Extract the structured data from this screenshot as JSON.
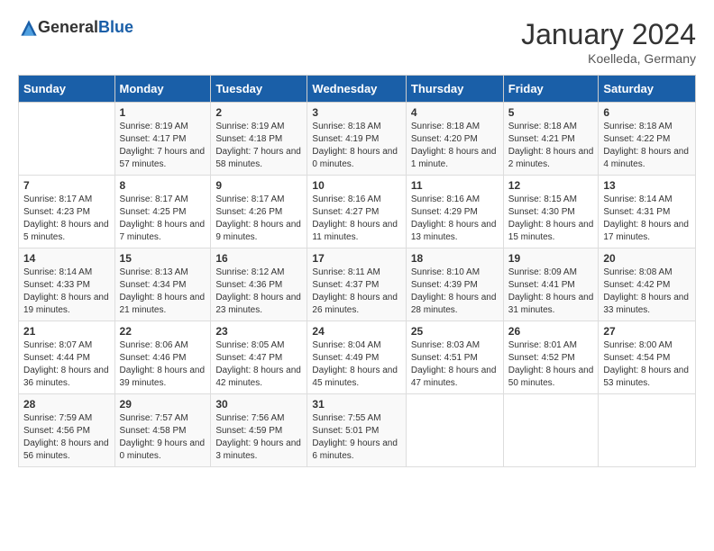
{
  "header": {
    "logo_general": "General",
    "logo_blue": "Blue",
    "month_year": "January 2024",
    "location": "Koelleda, Germany"
  },
  "days_of_week": [
    "Sunday",
    "Monday",
    "Tuesday",
    "Wednesday",
    "Thursday",
    "Friday",
    "Saturday"
  ],
  "weeks": [
    [
      {
        "num": "",
        "sunrise": "",
        "sunset": "",
        "daylight": ""
      },
      {
        "num": "1",
        "sunrise": "Sunrise: 8:19 AM",
        "sunset": "Sunset: 4:17 PM",
        "daylight": "Daylight: 7 hours and 57 minutes."
      },
      {
        "num": "2",
        "sunrise": "Sunrise: 8:19 AM",
        "sunset": "Sunset: 4:18 PM",
        "daylight": "Daylight: 7 hours and 58 minutes."
      },
      {
        "num": "3",
        "sunrise": "Sunrise: 8:18 AM",
        "sunset": "Sunset: 4:19 PM",
        "daylight": "Daylight: 8 hours and 0 minutes."
      },
      {
        "num": "4",
        "sunrise": "Sunrise: 8:18 AM",
        "sunset": "Sunset: 4:20 PM",
        "daylight": "Daylight: 8 hours and 1 minute."
      },
      {
        "num": "5",
        "sunrise": "Sunrise: 8:18 AM",
        "sunset": "Sunset: 4:21 PM",
        "daylight": "Daylight: 8 hours and 2 minutes."
      },
      {
        "num": "6",
        "sunrise": "Sunrise: 8:18 AM",
        "sunset": "Sunset: 4:22 PM",
        "daylight": "Daylight: 8 hours and 4 minutes."
      }
    ],
    [
      {
        "num": "7",
        "sunrise": "Sunrise: 8:17 AM",
        "sunset": "Sunset: 4:23 PM",
        "daylight": "Daylight: 8 hours and 5 minutes."
      },
      {
        "num": "8",
        "sunrise": "Sunrise: 8:17 AM",
        "sunset": "Sunset: 4:25 PM",
        "daylight": "Daylight: 8 hours and 7 minutes."
      },
      {
        "num": "9",
        "sunrise": "Sunrise: 8:17 AM",
        "sunset": "Sunset: 4:26 PM",
        "daylight": "Daylight: 8 hours and 9 minutes."
      },
      {
        "num": "10",
        "sunrise": "Sunrise: 8:16 AM",
        "sunset": "Sunset: 4:27 PM",
        "daylight": "Daylight: 8 hours and 11 minutes."
      },
      {
        "num": "11",
        "sunrise": "Sunrise: 8:16 AM",
        "sunset": "Sunset: 4:29 PM",
        "daylight": "Daylight: 8 hours and 13 minutes."
      },
      {
        "num": "12",
        "sunrise": "Sunrise: 8:15 AM",
        "sunset": "Sunset: 4:30 PM",
        "daylight": "Daylight: 8 hours and 15 minutes."
      },
      {
        "num": "13",
        "sunrise": "Sunrise: 8:14 AM",
        "sunset": "Sunset: 4:31 PM",
        "daylight": "Daylight: 8 hours and 17 minutes."
      }
    ],
    [
      {
        "num": "14",
        "sunrise": "Sunrise: 8:14 AM",
        "sunset": "Sunset: 4:33 PM",
        "daylight": "Daylight: 8 hours and 19 minutes."
      },
      {
        "num": "15",
        "sunrise": "Sunrise: 8:13 AM",
        "sunset": "Sunset: 4:34 PM",
        "daylight": "Daylight: 8 hours and 21 minutes."
      },
      {
        "num": "16",
        "sunrise": "Sunrise: 8:12 AM",
        "sunset": "Sunset: 4:36 PM",
        "daylight": "Daylight: 8 hours and 23 minutes."
      },
      {
        "num": "17",
        "sunrise": "Sunrise: 8:11 AM",
        "sunset": "Sunset: 4:37 PM",
        "daylight": "Daylight: 8 hours and 26 minutes."
      },
      {
        "num": "18",
        "sunrise": "Sunrise: 8:10 AM",
        "sunset": "Sunset: 4:39 PM",
        "daylight": "Daylight: 8 hours and 28 minutes."
      },
      {
        "num": "19",
        "sunrise": "Sunrise: 8:09 AM",
        "sunset": "Sunset: 4:41 PM",
        "daylight": "Daylight: 8 hours and 31 minutes."
      },
      {
        "num": "20",
        "sunrise": "Sunrise: 8:08 AM",
        "sunset": "Sunset: 4:42 PM",
        "daylight": "Daylight: 8 hours and 33 minutes."
      }
    ],
    [
      {
        "num": "21",
        "sunrise": "Sunrise: 8:07 AM",
        "sunset": "Sunset: 4:44 PM",
        "daylight": "Daylight: 8 hours and 36 minutes."
      },
      {
        "num": "22",
        "sunrise": "Sunrise: 8:06 AM",
        "sunset": "Sunset: 4:46 PM",
        "daylight": "Daylight: 8 hours and 39 minutes."
      },
      {
        "num": "23",
        "sunrise": "Sunrise: 8:05 AM",
        "sunset": "Sunset: 4:47 PM",
        "daylight": "Daylight: 8 hours and 42 minutes."
      },
      {
        "num": "24",
        "sunrise": "Sunrise: 8:04 AM",
        "sunset": "Sunset: 4:49 PM",
        "daylight": "Daylight: 8 hours and 45 minutes."
      },
      {
        "num": "25",
        "sunrise": "Sunrise: 8:03 AM",
        "sunset": "Sunset: 4:51 PM",
        "daylight": "Daylight: 8 hours and 47 minutes."
      },
      {
        "num": "26",
        "sunrise": "Sunrise: 8:01 AM",
        "sunset": "Sunset: 4:52 PM",
        "daylight": "Daylight: 8 hours and 50 minutes."
      },
      {
        "num": "27",
        "sunrise": "Sunrise: 8:00 AM",
        "sunset": "Sunset: 4:54 PM",
        "daylight": "Daylight: 8 hours and 53 minutes."
      }
    ],
    [
      {
        "num": "28",
        "sunrise": "Sunrise: 7:59 AM",
        "sunset": "Sunset: 4:56 PM",
        "daylight": "Daylight: 8 hours and 56 minutes."
      },
      {
        "num": "29",
        "sunrise": "Sunrise: 7:57 AM",
        "sunset": "Sunset: 4:58 PM",
        "daylight": "Daylight: 9 hours and 0 minutes."
      },
      {
        "num": "30",
        "sunrise": "Sunrise: 7:56 AM",
        "sunset": "Sunset: 4:59 PM",
        "daylight": "Daylight: 9 hours and 3 minutes."
      },
      {
        "num": "31",
        "sunrise": "Sunrise: 7:55 AM",
        "sunset": "Sunset: 5:01 PM",
        "daylight": "Daylight: 9 hours and 6 minutes."
      },
      {
        "num": "",
        "sunrise": "",
        "sunset": "",
        "daylight": ""
      },
      {
        "num": "",
        "sunrise": "",
        "sunset": "",
        "daylight": ""
      },
      {
        "num": "",
        "sunrise": "",
        "sunset": "",
        "daylight": ""
      }
    ]
  ]
}
